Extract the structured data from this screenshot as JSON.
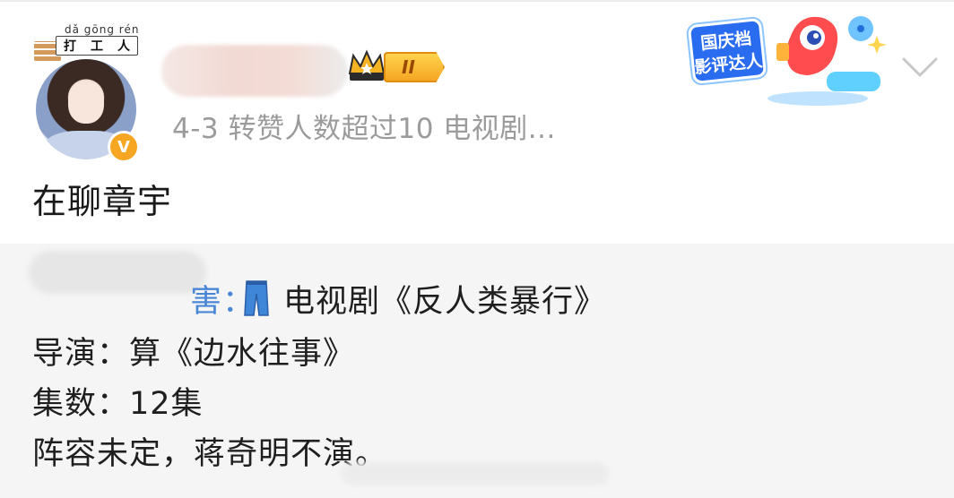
{
  "author": {
    "avatar_pinyin": "dǎ gōng rén",
    "avatar_tag": [
      "打",
      "工",
      "人"
    ],
    "verified_badge": "V",
    "level_badge": "II",
    "level_icon": "crown-icon"
  },
  "meta": {
    "text": "4-3 转赞人数超过10   电视剧..."
  },
  "event_badge": {
    "line1": "国庆档",
    "line2": "影评达人"
  },
  "post": {
    "text": "在聊章宇"
  },
  "repost": {
    "line1_tail": "害：",
    "line1_rest": "电视剧《反人类暴行》",
    "line2": "导演：算《边水往事》",
    "line3": "集数：12集",
    "line4": "阵容未定，蒋奇明不演。"
  },
  "colors": {
    "meta_gray": "#9b9b9b",
    "repost_bg": "#f5f5f5",
    "badge_orange": "#f6a623",
    "event_blue": "#2a6cf0"
  }
}
